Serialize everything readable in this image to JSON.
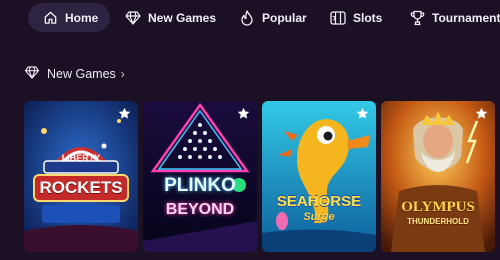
{
  "nav": {
    "items": [
      {
        "label": "Home",
        "icon": "home-icon",
        "active": true
      },
      {
        "label": "New Games",
        "icon": "diamond-icon"
      },
      {
        "label": "Popular",
        "icon": "flame-icon"
      },
      {
        "label": "Slots",
        "icon": "slots-icon"
      },
      {
        "label": "Tournaments",
        "icon": "trophy-icon"
      }
    ]
  },
  "section": {
    "title": "New Games",
    "icon": "diamond-icon",
    "chevron": "›"
  },
  "games": [
    {
      "line1": "LIBERTY",
      "line2": "ROCKETS"
    },
    {
      "line1": "PLINKO",
      "line2": "BEYOND"
    },
    {
      "line1": "SEAHORSE",
      "line2": "Surge"
    },
    {
      "line1": "OLYMPUS",
      "line2": "THUNDERHOLD"
    }
  ],
  "colors": {
    "background": "#1b1024",
    "active_tab": "#2e2340",
    "text": "#f2eef6"
  }
}
